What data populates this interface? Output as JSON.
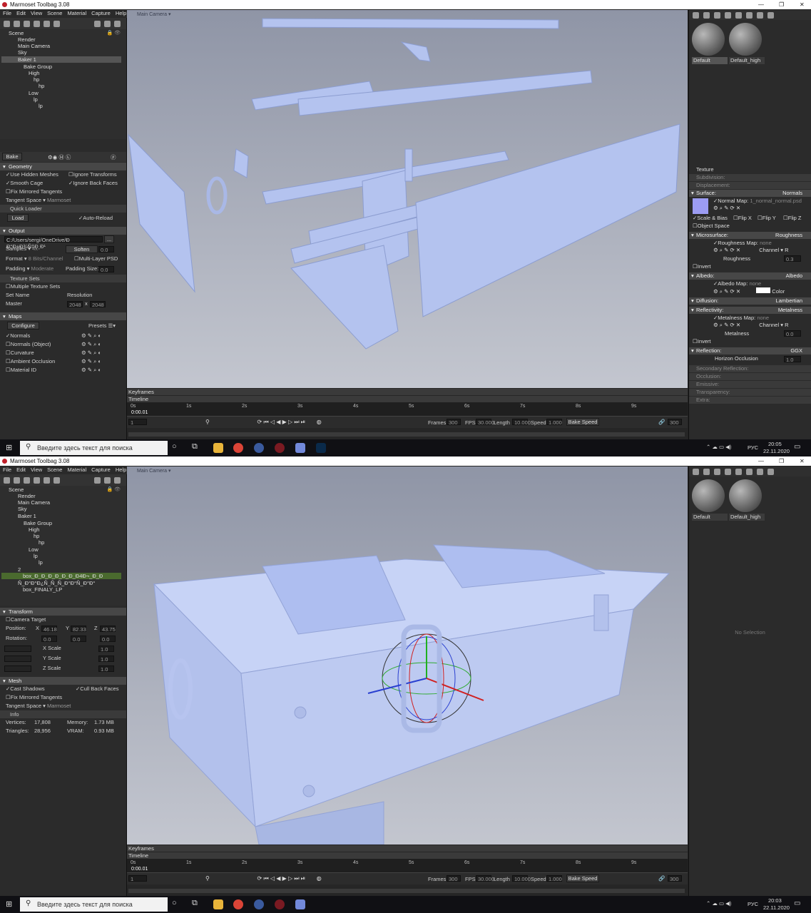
{
  "app": {
    "title": "Marmoset Toolbag 3.08",
    "menu": [
      "File",
      "Edit",
      "View",
      "Scene",
      "Material",
      "Capture",
      "Help"
    ]
  },
  "viewport": {
    "camera_label": "Main Camera ▾"
  },
  "top": {
    "tree": [
      "Scene",
      "Render",
      "Main Camera",
      "Sky",
      "Baker 1",
      "Bake Group",
      "High",
      "hp",
      "hp",
      "Low",
      "lp",
      "lp"
    ],
    "bake": {
      "bake_label": "Bake",
      "geometry": "Geometry",
      "use_hidden": "Use Hidden Meshes",
      "ignore_transforms": "Ignore Transforms",
      "smooth_cage": "Smooth Cage",
      "ignore_back": "Ignore Back Faces",
      "fix_mirrored": "Fix Mirrored Tangents",
      "tangent_space": "Tangent Space ▾",
      "tangent_value": "Marmoset",
      "quick_loader": "Quick Loader",
      "load": "Load",
      "auto_reload": "Auto-Reload",
      "output": "Output",
      "path": "C:/Users/sergi/OneDrive/Ð Ð°Ð±Ð¾Ñ‡Ð¸Ð¹",
      "samples": "Samples ▾",
      "samples_val": "4x",
      "soften": "Soften",
      "soften_val": "0.0",
      "format": "Format ▾",
      "format_val": "8 Bits/Channel",
      "multilayer": "Multi-Layer PSD",
      "padding": "Padding ▾",
      "padding_val": "Moderate",
      "padding_size": "Padding Size:",
      "padding_size_val": "0.0",
      "texture_sets": "Texture Sets",
      "multiple_sets": "Multiple Texture Sets",
      "set_name": "Set Name",
      "resolution": "Resolution",
      "master": "Master",
      "res_w": "2048",
      "res_x": "x",
      "res_h": "2048",
      "maps": "Maps",
      "configure": "Configure",
      "presets": "Presets ☰▾",
      "map_list": [
        "Normals",
        "Normals (Object)",
        "Curvature",
        "Ambient Occlusion",
        "Material ID"
      ]
    },
    "materials": [
      "Default",
      "Default_high"
    ],
    "texture": "Texture",
    "subdivision": "Subdivision:",
    "displacement": "Displacement:",
    "surface": "Surface:",
    "surface_val": "Normals",
    "normal_map": "Normal Map:",
    "normal_file": "1_normal_normal.psd",
    "scale_bias": "Scale & Bias",
    "flipx": "Flip X",
    "flipy": "Flip Y",
    "flipz": "Flip Z",
    "object_space": "Object Space",
    "microsurface": "Microsurface:",
    "micro_val": "Roughness",
    "roughness_map": "Roughness Map:",
    "none": "none",
    "channel": "Channel ▾",
    "channel_r": "R",
    "roughness": "Roughness",
    "roughness_val": "0.3",
    "invert": "Invert",
    "albedo": "Albedo:",
    "albedo_val": "Albedo",
    "albedo_map": "Albedo Map:",
    "color": "Color",
    "diffusion": "Diffusion:",
    "diffusion_val": "Lambertian",
    "reflectivity": "Reflectivity:",
    "reflectivity_val": "Metalness",
    "metalness_map": "Metalness Map:",
    "metalness": "Metalness",
    "metalness_val": "0.0",
    "reflection": "Reflection:",
    "reflection_val": "GGX",
    "horizon": "Horizon Occlusion",
    "horizon_val": "1.0",
    "secondary": "Secondary Reflection:",
    "occlusion": "Occlusion:",
    "emissive": "Emissive:",
    "transparency": "Transparency:",
    "extra": "Extra:",
    "time": "20:05",
    "date": "22.11.2020"
  },
  "bottom": {
    "tree": [
      "Scene",
      "Render",
      "Main Camera",
      "Sky",
      "Baker 1",
      "Bake Group",
      "High",
      "hp",
      "hp",
      "Low",
      "lp",
      "lp",
      "2",
      "box_Ð_Ð_Ð_Ð_Ð_Ð_Ð4Ð¬_Ð_Ð",
      "Ñ_Ð°Ð°Ð¿Ñ_Ñ_Ñ_Ð°Ð°Ñ_Ð°Ð°",
      "box_FINALY_LP"
    ],
    "transform": "Transform",
    "camera_target": "Camera Target",
    "position": "Position:",
    "x": "X",
    "px": "46.18",
    "y": "Y",
    "py": "82.33",
    "z": "Z",
    "pz": "43.75",
    "rotation": "Rotation:",
    "rx": "0.0",
    "ry": "0.0",
    "rz": "0.0",
    "xscale": "X Scale",
    "yscale": "Y Scale",
    "zscale": "Z Scale",
    "one": "1.0",
    "mesh": "Mesh",
    "cast_shadows": "Cast Shadows",
    "cull_back": "Cull Back Faces",
    "fix_mirrored": "Fix Mirrored Tangents",
    "tangent_space": "Tangent Space ▾",
    "tangent_value": "Marmoset",
    "info": "Info",
    "vertices": "Vertices:",
    "vertices_val": "17,808",
    "memory": "Memory:",
    "memory_val": "1.73 MB",
    "triangles": "Triangles:",
    "triangles_val": "28,956",
    "vram": "VRAM:",
    "vram_val": "0.93 MB",
    "materials": [
      "Default",
      "Default_high"
    ],
    "no_selection": "No Selection",
    "time": "20:03",
    "date": "22.11.2020"
  },
  "timeline": {
    "keyframes": "Keyframes",
    "timeline": "Timeline",
    "time": "0:00.01",
    "ticks": [
      "0s",
      "1s",
      "2s",
      "3s",
      "4s",
      "5s",
      "6s",
      "7s",
      "8s",
      "9s"
    ],
    "frame": "1",
    "frames": "Frames",
    "frames_val": "300",
    "fps": "FPS",
    "fps_val": "30.000",
    "length": "Length",
    "length_val": "10.000",
    "speed": "Speed",
    "speed_val": "1.000",
    "bake_speed": "Bake Speed",
    "end_frame": "300"
  },
  "taskbar": {
    "search": "Введите здесь текст для поиска",
    "lang": "РУС"
  }
}
